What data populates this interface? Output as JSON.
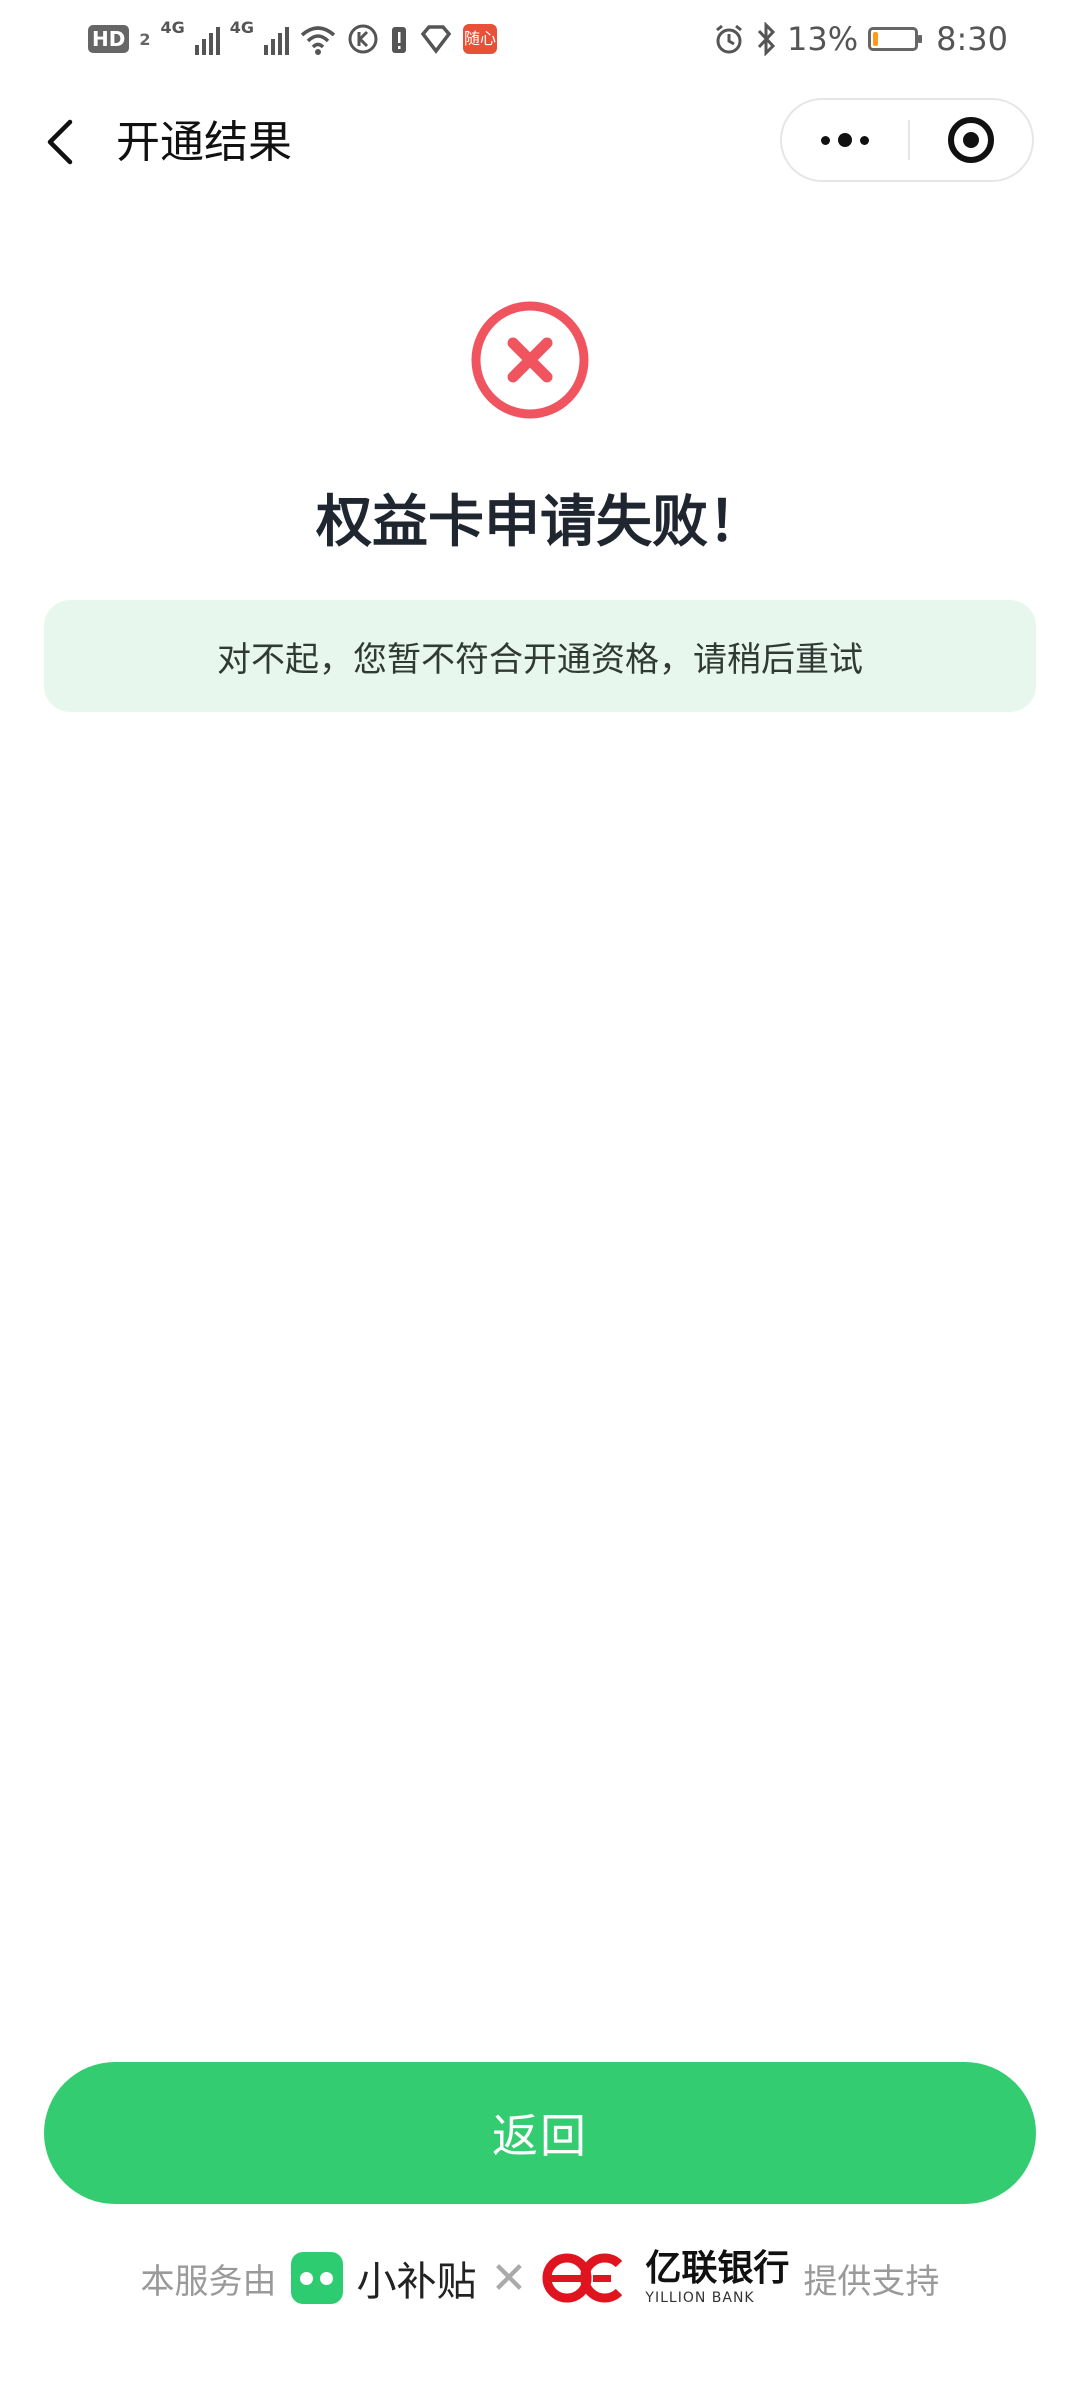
{
  "status_bar": {
    "hd_label": "HD",
    "hd_sub": "2",
    "network_1": "4G",
    "network_2": "4G",
    "app_label": "随心",
    "battery_percent": "13%",
    "battery_level": 0.13,
    "time": "8:30"
  },
  "nav": {
    "title": "开通结果"
  },
  "result": {
    "title": "权益卡申请失败！",
    "message": "对不起，您暂不符合开通资格，请稍后重试",
    "accent_color": "#f0545f"
  },
  "actions": {
    "return_label": "返回",
    "button_color": "#33cc70"
  },
  "footer": {
    "prefix": "本服务由",
    "partner_name": "小补贴",
    "separator": "✕",
    "bank_name": "亿联银行",
    "bank_name_en": "YILLION BANK",
    "suffix": "提供支持",
    "bank_color": "#e0141e"
  },
  "icons": {
    "back": "chevron-left-icon",
    "more": "more-dots-icon",
    "close": "target-icon",
    "fail": "error-circle-icon"
  }
}
